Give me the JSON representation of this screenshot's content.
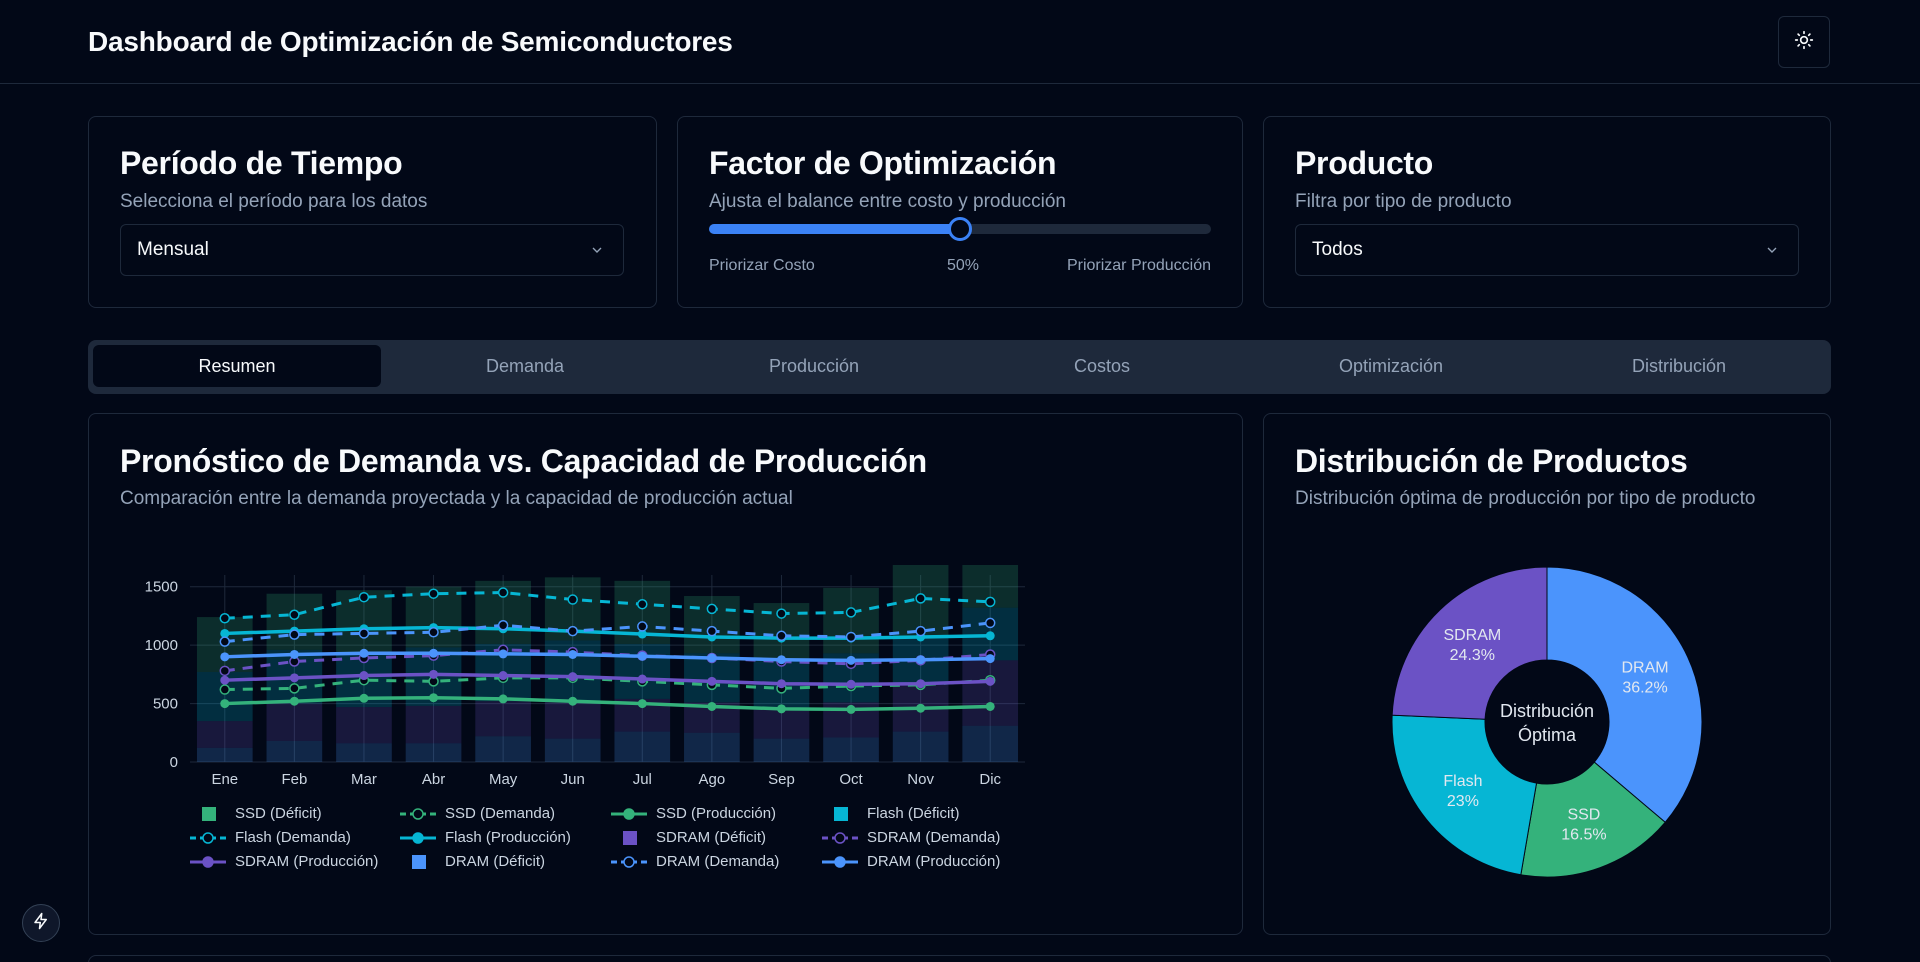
{
  "header": {
    "title": "Dashboard de Optimización de Semiconductores",
    "theme_icon": "sun-icon"
  },
  "filters": {
    "period": {
      "title": "Período de Tiempo",
      "description": "Selecciona el período para los datos",
      "selected": "Mensual"
    },
    "optimization": {
      "title": "Factor de Optimización",
      "description": "Ajusta el balance entre costo y producción",
      "value": 50,
      "value_label": "50%",
      "left_label": "Priorizar Costo",
      "right_label": "Priorizar Producción"
    },
    "product": {
      "title": "Producto",
      "description": "Filtra por tipo de producto",
      "selected": "Todos"
    }
  },
  "tabs": [
    "Resumen",
    "Demanda",
    "Producción",
    "Costos",
    "Optimización",
    "Distribución"
  ],
  "active_tab": "Resumen",
  "forecast": {
    "title": "Pronóstico de Demanda vs. Capacidad de Producción",
    "description": "Comparación entre la demanda proyectada y la capacidad de producción actual"
  },
  "distribution": {
    "title": "Distribución de Productos",
    "description": "Distribución óptima de producción por tipo de producto",
    "center_line1": "Distribución",
    "center_line2": "Óptima"
  },
  "colors": {
    "SSD": "#34b27b",
    "Flash": "#06b6d4",
    "SDRAM": "#6b52c5",
    "DRAM": "#4b94fc"
  },
  "chart_data": [
    {
      "type": "line",
      "title": "",
      "categories": [
        "Ene",
        "Feb",
        "Mar",
        "Abr",
        "May",
        "Jun",
        "Jul",
        "Ago",
        "Sep",
        "Oct",
        "Nov",
        "Dic"
      ],
      "ylim": [
        0,
        1600
      ],
      "yticks": [
        0,
        500,
        1000,
        1500
      ],
      "grid": true,
      "legend_position": "bottom",
      "series": [
        {
          "name": "SSD (Déficit)",
          "kind": "bar",
          "color": "#34b27b",
          "values": [
            470,
            480,
            530,
            520,
            540,
            540,
            540,
            490,
            500,
            560,
            660,
            590
          ]
        },
        {
          "name": "SSD (Demanda)",
          "kind": "dashed",
          "color": "#34b27b",
          "values": [
            620,
            630,
            700,
            690,
            720,
            720,
            690,
            660,
            630,
            650,
            660,
            700
          ]
        },
        {
          "name": "SSD (Producción)",
          "kind": "solid",
          "color": "#34b27b",
          "values": [
            500,
            520,
            545,
            550,
            540,
            520,
            500,
            475,
            455,
            450,
            460,
            475
          ]
        },
        {
          "name": "Flash (Déficit)",
          "kind": "bar",
          "color": "#06b6d4",
          "values": [
            420,
            460,
            470,
            500,
            490,
            520,
            470,
            420,
            400,
            420,
            420,
            450
          ]
        },
        {
          "name": "Flash (Demanda)",
          "kind": "dashed",
          "color": "#06b6d4",
          "values": [
            1230,
            1260,
            1410,
            1440,
            1450,
            1390,
            1350,
            1310,
            1270,
            1280,
            1400,
            1370
          ]
        },
        {
          "name": "Flash (Producción)",
          "kind": "solid",
          "color": "#06b6d4",
          "values": [
            1100,
            1120,
            1140,
            1150,
            1140,
            1120,
            1095,
            1070,
            1060,
            1060,
            1070,
            1080
          ]
        },
        {
          "name": "SDRAM (Déficit)",
          "kind": "bar",
          "color": "#6b52c5",
          "values": [
            230,
            320,
            310,
            320,
            300,
            320,
            280,
            260,
            260,
            300,
            400,
            560
          ]
        },
        {
          "name": "SDRAM (Demanda)",
          "kind": "dashed",
          "color": "#6b52c5",
          "values": [
            780,
            860,
            890,
            910,
            960,
            940,
            910,
            890,
            860,
            840,
            870,
            920
          ]
        },
        {
          "name": "SDRAM (Producción)",
          "kind": "solid",
          "color": "#6b52c5",
          "values": [
            700,
            720,
            740,
            750,
            740,
            730,
            710,
            690,
            670,
            665,
            670,
            690
          ]
        },
        {
          "name": "DRAM (Déficit)",
          "kind": "bar",
          "color": "#4b94fc",
          "values": [
            120,
            180,
            160,
            160,
            220,
            200,
            260,
            250,
            200,
            210,
            260,
            310
          ]
        },
        {
          "name": "DRAM (Demanda)",
          "kind": "dashed",
          "color": "#4b94fc",
          "values": [
            1030,
            1090,
            1100,
            1110,
            1170,
            1120,
            1160,
            1120,
            1080,
            1070,
            1120,
            1190
          ]
        },
        {
          "name": "DRAM (Producción)",
          "kind": "solid",
          "color": "#4b94fc",
          "values": [
            900,
            920,
            930,
            930,
            925,
            920,
            905,
            890,
            875,
            870,
            875,
            885
          ]
        }
      ]
    },
    {
      "type": "pie",
      "title": "",
      "slices": [
        {
          "name": "DRAM",
          "value": 36.2,
          "label": "36.2%",
          "color": "#4b94fc"
        },
        {
          "name": "SSD",
          "value": 16.5,
          "label": "16.5%",
          "color": "#34b27b"
        },
        {
          "name": "Flash",
          "value": 23,
          "label": "23%",
          "color": "#06b6d4"
        },
        {
          "name": "SDRAM",
          "value": 24.3,
          "label": "24.3%",
          "color": "#6b52c5"
        }
      ]
    }
  ]
}
